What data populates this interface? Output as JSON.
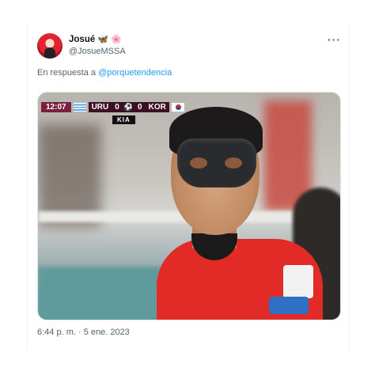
{
  "tweet": {
    "display_name": "Josué",
    "name_emojis": [
      "🦋",
      "🌸"
    ],
    "handle": "@JosueMSSA",
    "more_icon": "more-horizontal-icon",
    "reply_prefix": "En respuesta a",
    "reply_to": "@porquetendencia",
    "timestamp": "6:44 p. m. · 5 ene. 2023"
  },
  "media": {
    "scorebug": {
      "clock": "12:07",
      "home_team": "URU",
      "home_score": "0",
      "away_score": "0",
      "away_team": "KOR",
      "home_flag": "uruguay-flag",
      "away_flag": "korea-flag",
      "ball_icon": "soccer-ball-icon"
    },
    "sponsor": "KIA"
  },
  "colors": {
    "link": "#1d9bf0",
    "secondary_text": "#536471",
    "scorebug_time_bg": "#7a1f3d",
    "scorebug_bg": "#3b1020"
  }
}
